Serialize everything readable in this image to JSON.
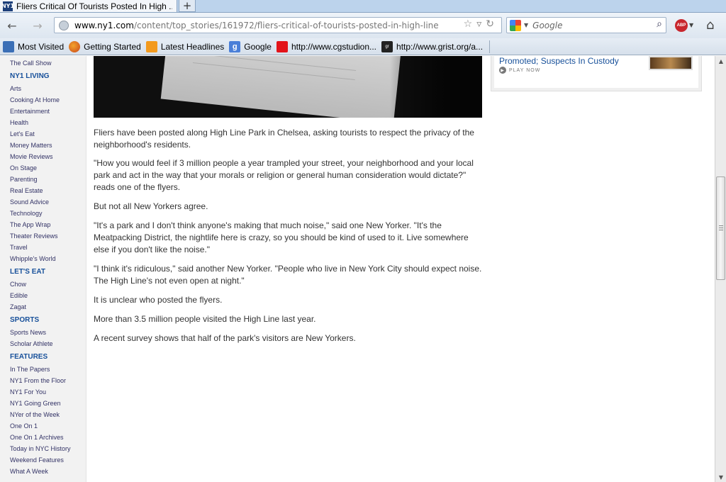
{
  "browser": {
    "tab_title": "Fliers Critical Of Tourists Posted In High ...",
    "new_tab_label": "+",
    "url_host": "www.ny1.com",
    "url_path": "/content/top_stories/161972/fliers-critical-of-tourists-posted-in-high-line",
    "search_placeholder": "Google",
    "favicon_text": "NY1",
    "abp_label": "ABP",
    "icons": {
      "back": "back-arrow-icon",
      "forward": "forward-arrow-icon",
      "star": "star-icon",
      "reload": "reload-icon",
      "search": "magnifier-icon",
      "home": "home-icon"
    }
  },
  "bookmarks": [
    {
      "label": "Most Visited"
    },
    {
      "label": "Getting Started"
    },
    {
      "label": "Latest Headlines"
    },
    {
      "label": "Google"
    },
    {
      "label": "http://www.cgstudion..."
    },
    {
      "label": "http://www.grist.org/a..."
    }
  ],
  "sidebar": {
    "top_link": "The Call Show",
    "sections": [
      {
        "heading": "NY1 LIVING",
        "items": [
          "Arts",
          "Cooking At Home",
          "Entertainment",
          "Health",
          "Let's Eat",
          "Money Matters",
          "Movie Reviews",
          "On Stage",
          "Parenting",
          "Real Estate",
          "Sound Advice",
          "Technology",
          "The App Wrap",
          "Theater Reviews",
          "Travel",
          "Whipple's World"
        ]
      },
      {
        "heading": "LET'S EAT",
        "items": [
          "Chow",
          "Edible",
          "Zagat"
        ]
      },
      {
        "heading": "SPORTS",
        "items": [
          "Sports News",
          "Scholar Athlete"
        ]
      },
      {
        "heading": "FEATURES",
        "items": [
          "In The Papers",
          "NY1 From the Floor",
          "NY1 For You",
          "NY1 Going Green",
          "NYer of the Week",
          "One On 1",
          "One On 1 Archives",
          "Today in NYC History",
          "Weekend Features",
          "What A Week"
        ]
      }
    ]
  },
  "article": {
    "paragraphs": [
      "Fliers have been posted along High Line Park in Chelsea, asking tourists to respect the privacy of the neighborhood's residents.",
      "\"How you would feel if 3 million people a year trampled your street, your neighborhood and your local park and act in the way that your morals or religion or general human consideration would dictate?\" reads one of the flyers.",
      "But not all New Yorkers agree.",
      "\"It's a park and I don't think anyone's making that much noise,\" said one New Yorker. \"It's the Meatpacking District, the nightlife here is crazy, so you should be kind of used to it. Live somewhere else if you don't like the noise.\"",
      "\"I think it's ridiculous,\" said another New Yorker. \"People who live in New York City should expect noise. The High Line's not even open at night.\"",
      "It is unclear who posted the flyers.",
      "More than 3.5 million people visited the High Line last year.",
      "A recent survey shows that half of the park's visitors are New Yorkers."
    ]
  },
  "right_rail": {
    "story_title": "Promoted; Suspects In Custody",
    "play_label": "PLAY NOW"
  }
}
